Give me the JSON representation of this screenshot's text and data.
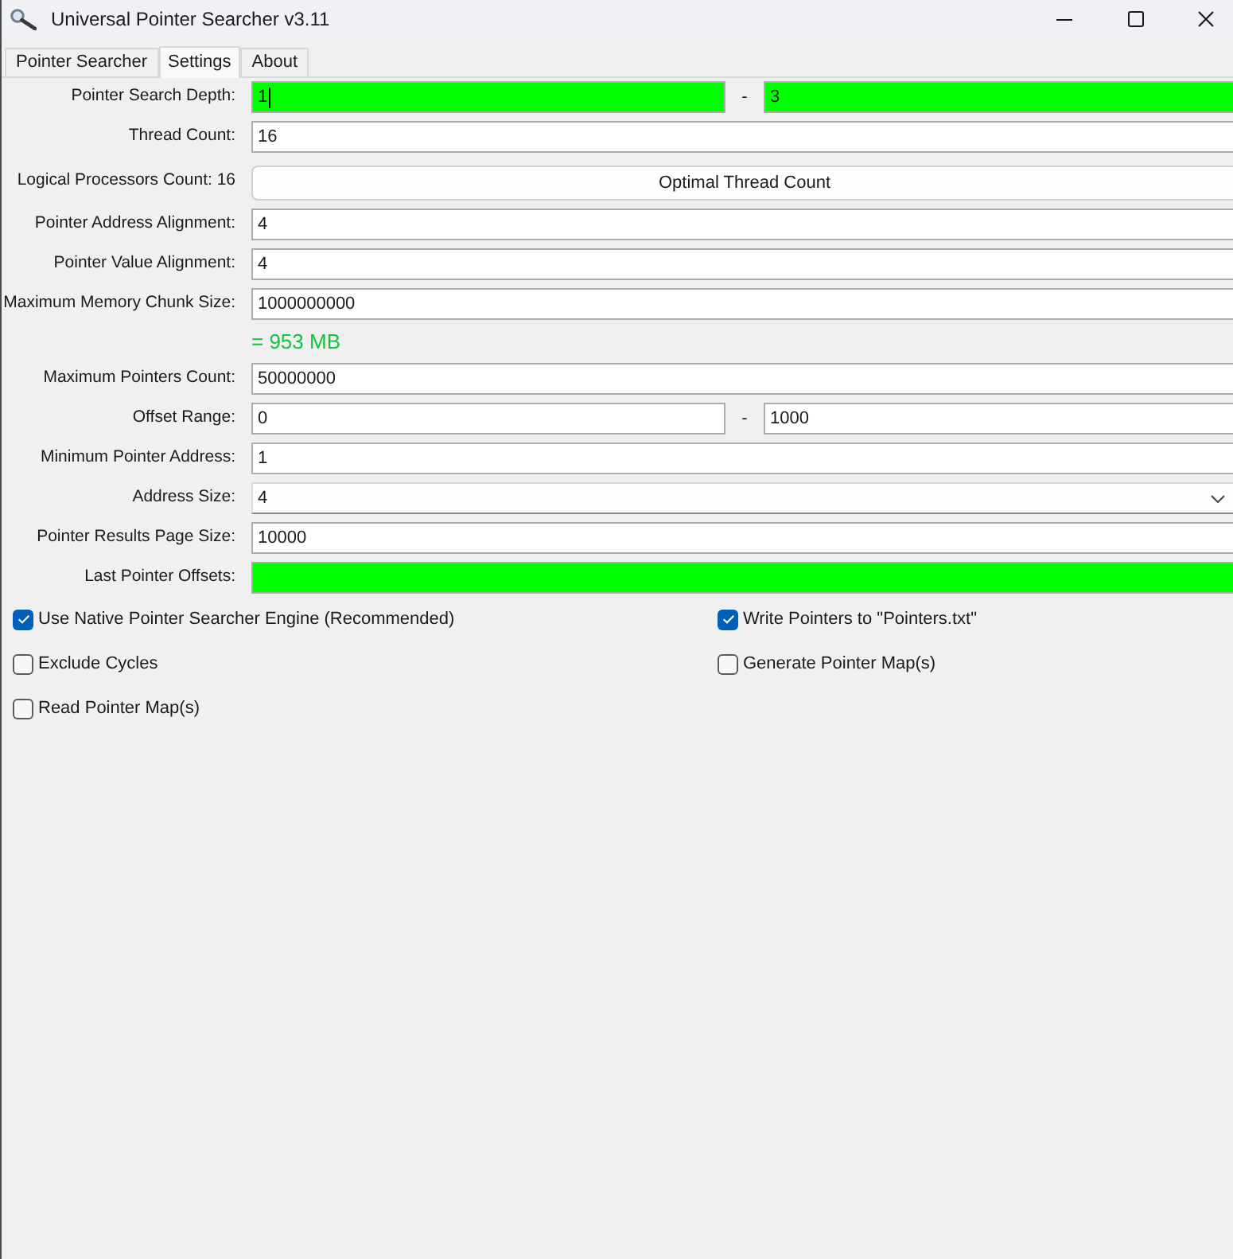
{
  "window": {
    "title": "Universal Pointer Searcher v3.11"
  },
  "tabs": [
    {
      "label": "Pointer Searcher",
      "selected": false
    },
    {
      "label": "Settings",
      "selected": true
    },
    {
      "label": "About",
      "selected": false
    }
  ],
  "settings": {
    "rows": [
      {
        "kind": "range",
        "label": "Pointer Search Depth:",
        "separator": "-",
        "fields": [
          {
            "value": "1",
            "highlighted": true,
            "focused": true
          },
          {
            "value": "3",
            "highlighted": true,
            "focused": false
          }
        ]
      },
      {
        "kind": "text",
        "label": "Thread Count:",
        "field": {
          "value": "16",
          "highlighted": false,
          "focused": false
        }
      },
      {
        "kind": "button",
        "label": "Logical Processors Count: 16",
        "button": "Optimal Thread Count"
      },
      {
        "kind": "text",
        "label": "Pointer Address Alignment:",
        "field": {
          "value": "4",
          "highlighted": false,
          "focused": false
        }
      },
      {
        "kind": "text",
        "label": "Pointer Value Alignment:",
        "field": {
          "value": "4",
          "highlighted": false,
          "focused": false
        }
      },
      {
        "kind": "text",
        "label": "Maximum Memory Chunk Size:",
        "field": {
          "value": "1000000000",
          "highlighted": false,
          "focused": false
        }
      },
      {
        "kind": "note",
        "text": "= 953 MB"
      },
      {
        "kind": "text",
        "label": "Maximum Pointers Count:",
        "field": {
          "value": "50000000",
          "highlighted": false,
          "focused": false
        }
      },
      {
        "kind": "range",
        "label": "Offset Range:",
        "separator": "-",
        "fields": [
          {
            "value": "0",
            "highlighted": false,
            "focused": false
          },
          {
            "value": "1000",
            "highlighted": false,
            "focused": false
          }
        ]
      },
      {
        "kind": "text",
        "label": "Minimum Pointer Address:",
        "field": {
          "value": "1",
          "highlighted": false,
          "focused": false
        }
      },
      {
        "kind": "dropdown",
        "label": "Address Size:",
        "value": "4"
      },
      {
        "kind": "text",
        "label": "Pointer Results Page Size:",
        "field": {
          "value": "10000",
          "highlighted": false,
          "focused": false
        }
      },
      {
        "kind": "text",
        "label": "Last Pointer Offsets:",
        "field": {
          "highlighted": true,
          "focused": false
        }
      }
    ],
    "options": [
      {
        "label": "Use Native Pointer Searcher Engine (Recommended)",
        "checked": true
      },
      {
        "label": "Write Pointers to \"Pointers.txt\"",
        "checked": true
      },
      {
        "label": "Exclude Cycles",
        "checked": false
      },
      {
        "label": "Generate Pointer Map(s)",
        "checked": false
      },
      {
        "label": "Read Pointer Map(s)",
        "checked": false
      }
    ]
  }
}
